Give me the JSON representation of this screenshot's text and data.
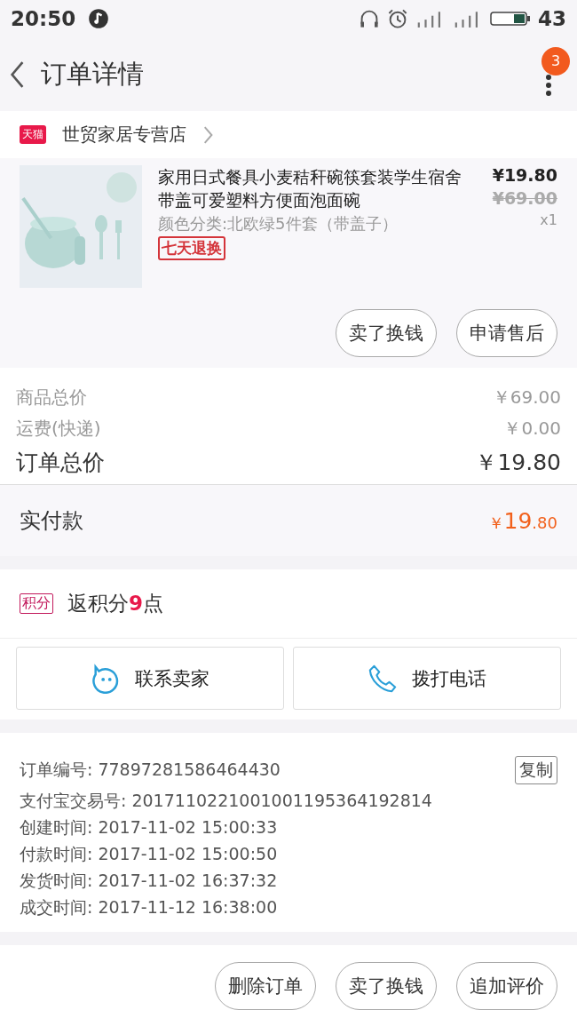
{
  "status_bar": {
    "time": "20:50",
    "battery": "43"
  },
  "header": {
    "title": "订单详情",
    "badge": "3"
  },
  "store": {
    "tag": "天猫",
    "name": "世贸家居专营店"
  },
  "item": {
    "kind": "picture",
    "title": "家用日式餐具小麦秸秆碗筷套装学生宿舍带盖可爱塑料方便面泡面碗",
    "sku": "颜色分类:北欧绿5件套（带盖子）",
    "tag": "七天退换",
    "price": "¥19.80",
    "original_price": "¥69.00",
    "quantity": "x1",
    "buttons": [
      "卖了换钱",
      "申请售后"
    ]
  },
  "summary": [
    {
      "label": "商品总价",
      "value": "￥69.00",
      "kind": "minor"
    },
    {
      "label": "运费(快递)",
      "value": "￥0.00",
      "kind": "minor"
    },
    {
      "label": "订单总价",
      "value": "￥19.80",
      "kind": "major"
    }
  ],
  "paid": {
    "label": "实付款",
    "currency": "￥",
    "integer": "19",
    "decimal": ".80"
  },
  "points": {
    "tag": "积分",
    "text": "返积分**9**点"
  },
  "contact": [
    {
      "label": "联系卖家",
      "kind": "chat"
    },
    {
      "label": "拨打电话",
      "kind": "phone"
    }
  ],
  "order_info": [
    {
      "text": "订单编号: 77897281586464430"
    },
    {
      "text": "支付宝交易号: 2017110221001001195364192814"
    },
    {
      "text": "创建时间: 2017-11-02 15:00:33"
    },
    {
      "text": "付款时间: 2017-11-02 15:00:50"
    },
    {
      "text": "发货时间: 2017-11-02 16:37:32"
    },
    {
      "text": "成交时间: 2017-11-12 16:38:00"
    }
  ],
  "copy_button": "复制",
  "bottom_buttons": [
    "删除订单",
    "卖了换钱",
    "追加评价"
  ]
}
